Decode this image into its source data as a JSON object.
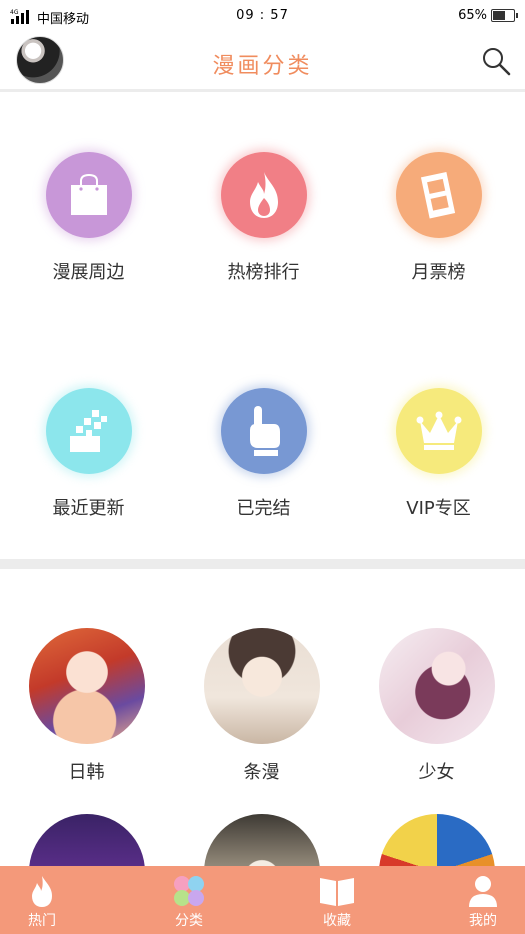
{
  "status_bar": {
    "network": "4G",
    "carrier": "中国移动",
    "time": "09 : 57",
    "battery": "65%",
    "battery_level": 0.65
  },
  "header": {
    "title": "漫画分类"
  },
  "categories": [
    {
      "label": "漫展周边",
      "color": "#c897d8",
      "icon": "shopping-bag-icon"
    },
    {
      "label": "热榜排行",
      "color": "#f17f86",
      "icon": "flame-icon"
    },
    {
      "label": "月票榜",
      "color": "#f6ab7a",
      "icon": "ticket-icon"
    },
    {
      "label": "最近更新",
      "color": "#8ce6ec",
      "icon": "pixel-update-icon"
    },
    {
      "label": "已完结",
      "color": "#7898d3",
      "icon": "pointing-hand-icon"
    },
    {
      "label": "VIP专区",
      "color": "#f6ea7c",
      "icon": "crown-icon"
    }
  ],
  "genres": [
    {
      "label": "日韩"
    },
    {
      "label": "条漫"
    },
    {
      "label": "少女"
    }
  ],
  "tabs": [
    {
      "label": "热门",
      "icon": "flame-icon"
    },
    {
      "label": "分类",
      "icon": "clover-icon"
    },
    {
      "label": "收藏",
      "icon": "book-icon"
    },
    {
      "label": "我的",
      "icon": "person-icon"
    }
  ]
}
